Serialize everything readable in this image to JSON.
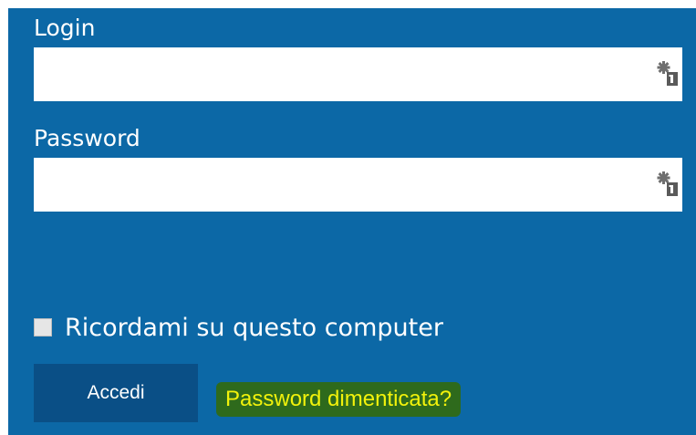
{
  "form": {
    "login_label": "Login",
    "login_value": "",
    "password_label": "Password",
    "password_value": "",
    "remember_label": "Ricordami su questo computer",
    "remember_checked": false,
    "submit_label": "Accedi",
    "forgot_link": "Password dimenticata?"
  },
  "icons": {
    "field_icon": "password-manager-key-icon"
  },
  "colors": {
    "panel_bg": "#0c68a6",
    "button_bg": "#0a4f86",
    "link_text": "#f2f20b",
    "link_highlight": "#2e6a1c"
  }
}
